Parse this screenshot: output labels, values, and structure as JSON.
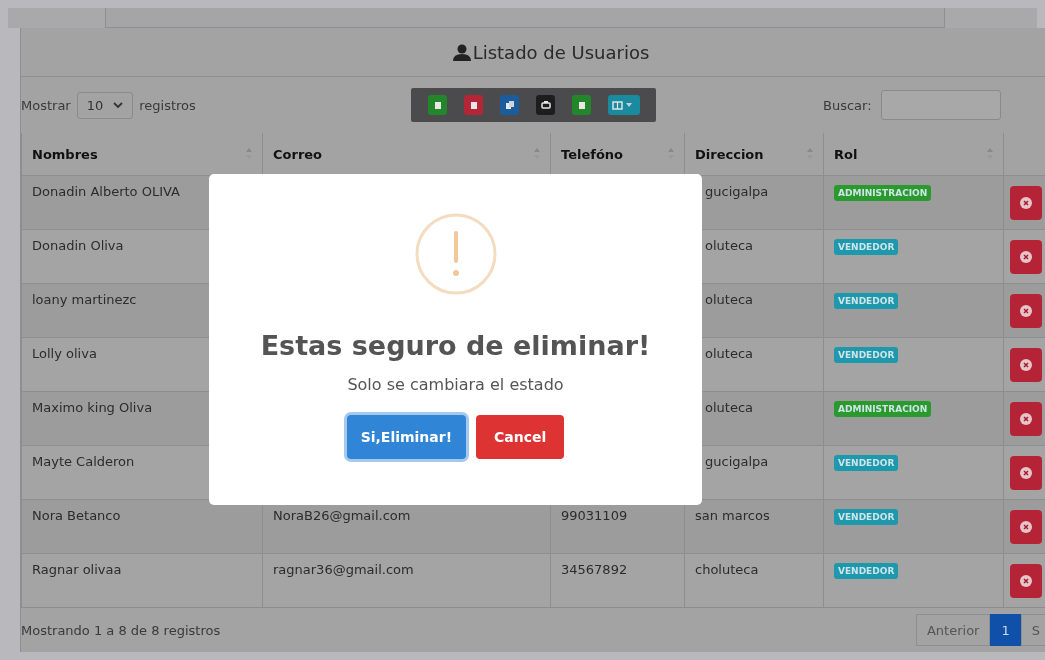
{
  "header": {
    "title": "Listado de Usuarios"
  },
  "length_control": {
    "label_before": "Mostrar",
    "value": "10",
    "label_after": "registros"
  },
  "toolbar": [
    {
      "kind": "excel"
    },
    {
      "kind": "pdf"
    },
    {
      "kind": "copy"
    },
    {
      "kind": "print"
    },
    {
      "kind": "csv"
    },
    {
      "kind": "columns"
    }
  ],
  "search": {
    "label": "Buscar:"
  },
  "table": {
    "columns": [
      {
        "label": "Nombres"
      },
      {
        "label": "Correo"
      },
      {
        "label": "Telefóno"
      },
      {
        "label": "Direccion"
      },
      {
        "label": "Rol"
      }
    ],
    "rows": [
      {
        "nombres": "Donadin Alberto OLIVA",
        "direccion": "gucigalpa",
        "rol": {
          "label": "ADMINISTRACION",
          "color": "#2a9a2e"
        }
      },
      {
        "nombres": "Donadin Oliva",
        "direccion": "oluteca",
        "rol": {
          "label": "VENDEDOR",
          "color": "#1d98ad"
        }
      },
      {
        "nombres": "loany martinezc",
        "direccion": "oluteca",
        "rol": {
          "label": "VENDEDOR",
          "color": "#1d98ad"
        }
      },
      {
        "nombres": "Lolly oliva",
        "direccion": "oluteca",
        "rol": {
          "label": "VENDEDOR",
          "color": "#1d98ad"
        }
      },
      {
        "nombres": "Maximo king Oliva",
        "direccion": "oluteca",
        "rol": {
          "label": "ADMINISTRACION",
          "color": "#2a9a2e"
        }
      },
      {
        "nombres": "Mayte Calderon",
        "direccion": "gucigalpa",
        "rol": {
          "label": "VENDEDOR",
          "color": "#1d98ad"
        }
      },
      {
        "nombres": "Nora Betanco",
        "correo": "NoraB26@gmail.com",
        "telefono": "99031109",
        "direccion": "san marcos",
        "rol": {
          "label": "VENDEDOR",
          "color": "#1d98ad"
        }
      },
      {
        "nombres": "Ragnar olivaa",
        "correo": "ragnar36@gmail.com",
        "telefono": "34567892",
        "direccion": "choluteca",
        "rol": {
          "label": "VENDEDOR",
          "color": "#1d98ad"
        }
      }
    ]
  },
  "footer": {
    "info": "Mostrando 1 a 8 de 8 registros",
    "pagination": [
      {
        "label": "Anterior",
        "selected": false
      },
      {
        "label": "1",
        "selected": true
      },
      {
        "label": "S",
        "selected": false
      }
    ]
  },
  "modal": {
    "title": "Estas seguro de eliminar!",
    "text": "Solo se cambiara el estado",
    "buttons": [
      {
        "label": "Si,Eliminar!",
        "kind": "confirm"
      },
      {
        "label": "Cancel",
        "kind": "cancel"
      }
    ]
  }
}
